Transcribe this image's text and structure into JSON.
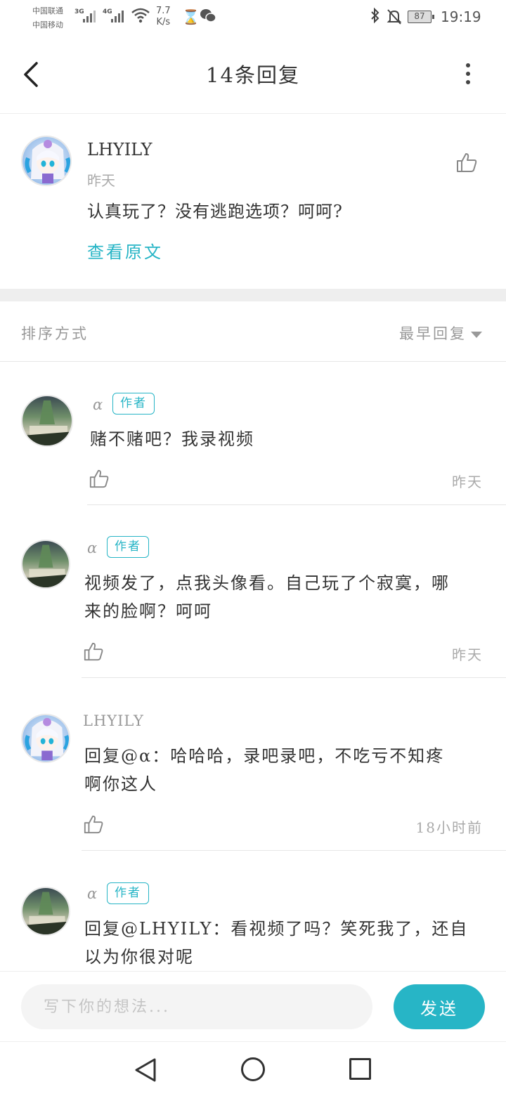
{
  "status_bar": {
    "carrier_1": "中国联通",
    "carrier_2": "中国移动",
    "network_1": "3G",
    "network_2": "4G",
    "speed_value": "7.7",
    "speed_unit": "K/s",
    "battery": "87",
    "time": "19:19"
  },
  "header": {
    "title": "14条回复"
  },
  "post": {
    "username": "LHYILY",
    "time": "昨天",
    "text": "认真玩了？没有逃跑选项？呵呵?",
    "view_original": "查看原文"
  },
  "sort": {
    "label": "排序方式",
    "selected": "最早回复"
  },
  "replies": [
    {
      "name": "α",
      "badge": "作者",
      "line1": "赌不赌吧？我录视频",
      "line2": "",
      "time": "昨天"
    },
    {
      "name": "α",
      "badge": "作者",
      "line1": "视频发了，点我头像看。自己玩了个寂寞，哪",
      "line2": "来的脸啊？呵呵",
      "time": "昨天"
    },
    {
      "name": "LHYILY",
      "badge": "",
      "line1": "回复@α：哈哈哈，录吧录吧，不吃亏不知疼",
      "line2": "啊你这人",
      "time": "18小时前"
    },
    {
      "name": "α",
      "badge": "作者",
      "line1": "回复@LHYILY：看视频了吗？笑死我了，还自",
      "line2": "以为你很对呢",
      "time": ""
    }
  ],
  "composer": {
    "placeholder": "写下你的想法...",
    "send_label": "发送"
  },
  "colors": {
    "accent": "#27b5c6",
    "muted": "#999999",
    "divider": "#eeeeee"
  },
  "icons": [
    "back-icon",
    "more-icon",
    "like-icon",
    "caret-down-icon",
    "nav-back-icon",
    "nav-home-icon",
    "nav-recent-icon"
  ]
}
